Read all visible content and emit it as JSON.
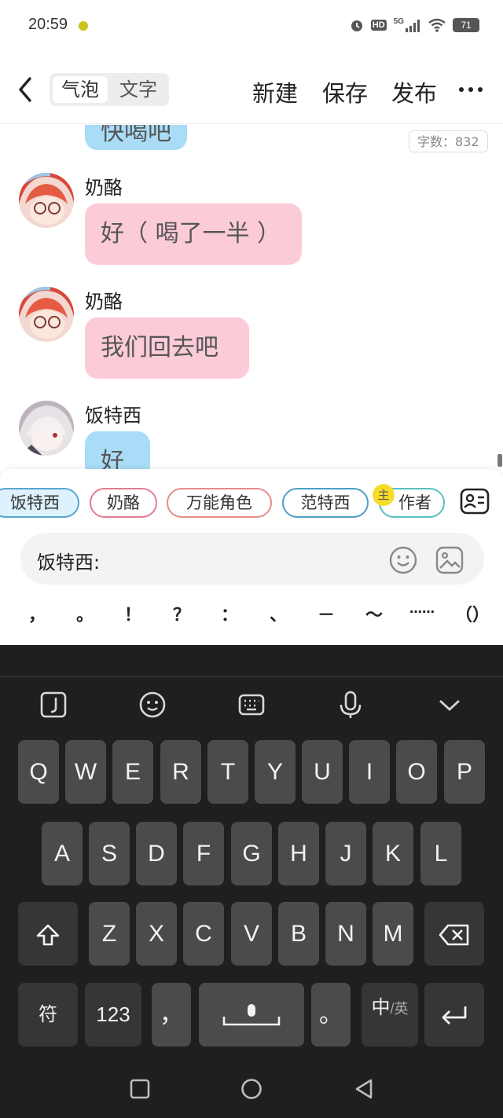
{
  "status_bar": {
    "time": "20:59",
    "battery": "71",
    "network": "5G",
    "hd": "HD"
  },
  "header": {
    "mode_toggle": [
      "气泡",
      "文字"
    ],
    "new_label": "新建",
    "save_label": "保存",
    "publish_label": "发布"
  },
  "chat": {
    "word_count": "字数：832",
    "top_partial_text": "快喝吧",
    "messages": [
      {
        "name": "奶酪",
        "text": "好（ 喝了一半 ）",
        "color": "#fccbd8"
      },
      {
        "name": "奶酪",
        "text": "我们回去吧",
        "color": "#fccbd8"
      },
      {
        "name": "饭特西",
        "text": "好",
        "color": "#a9dcf7"
      }
    ]
  },
  "roles": [
    {
      "name": "饭特西",
      "active": true
    },
    {
      "name": "奶酪",
      "active": false
    },
    {
      "name": "万能角色",
      "active": false
    },
    {
      "name": "范特西",
      "active": false
    },
    {
      "name": "作者",
      "active": false,
      "badge": "主"
    }
  ],
  "input": {
    "speaker_label": "饭特西:"
  },
  "punctuation": [
    "，",
    "。",
    "！",
    "？",
    "：",
    "、",
    "－",
    "～",
    "……",
    "（）"
  ],
  "keyboard": {
    "row1": [
      "Q",
      "W",
      "E",
      "R",
      "T",
      "Y",
      "U",
      "I",
      "O",
      "P"
    ],
    "row2": [
      "A",
      "S",
      "D",
      "F",
      "G",
      "H",
      "J",
      "K",
      "L"
    ],
    "row3": [
      "Z",
      "X",
      "C",
      "V",
      "B",
      "N",
      "M"
    ],
    "symbols_label": "符",
    "numbers_label": "123",
    "comma_label": "，",
    "period_label": "。",
    "lang_main": "中",
    "lang_sub": "/英"
  },
  "colors": {
    "pink_bubble": "#fccbd8",
    "blue_bubble": "#a9dcf7",
    "keyboard_bg": "#1f1f1f",
    "key_bg": "#4b4b4b"
  }
}
